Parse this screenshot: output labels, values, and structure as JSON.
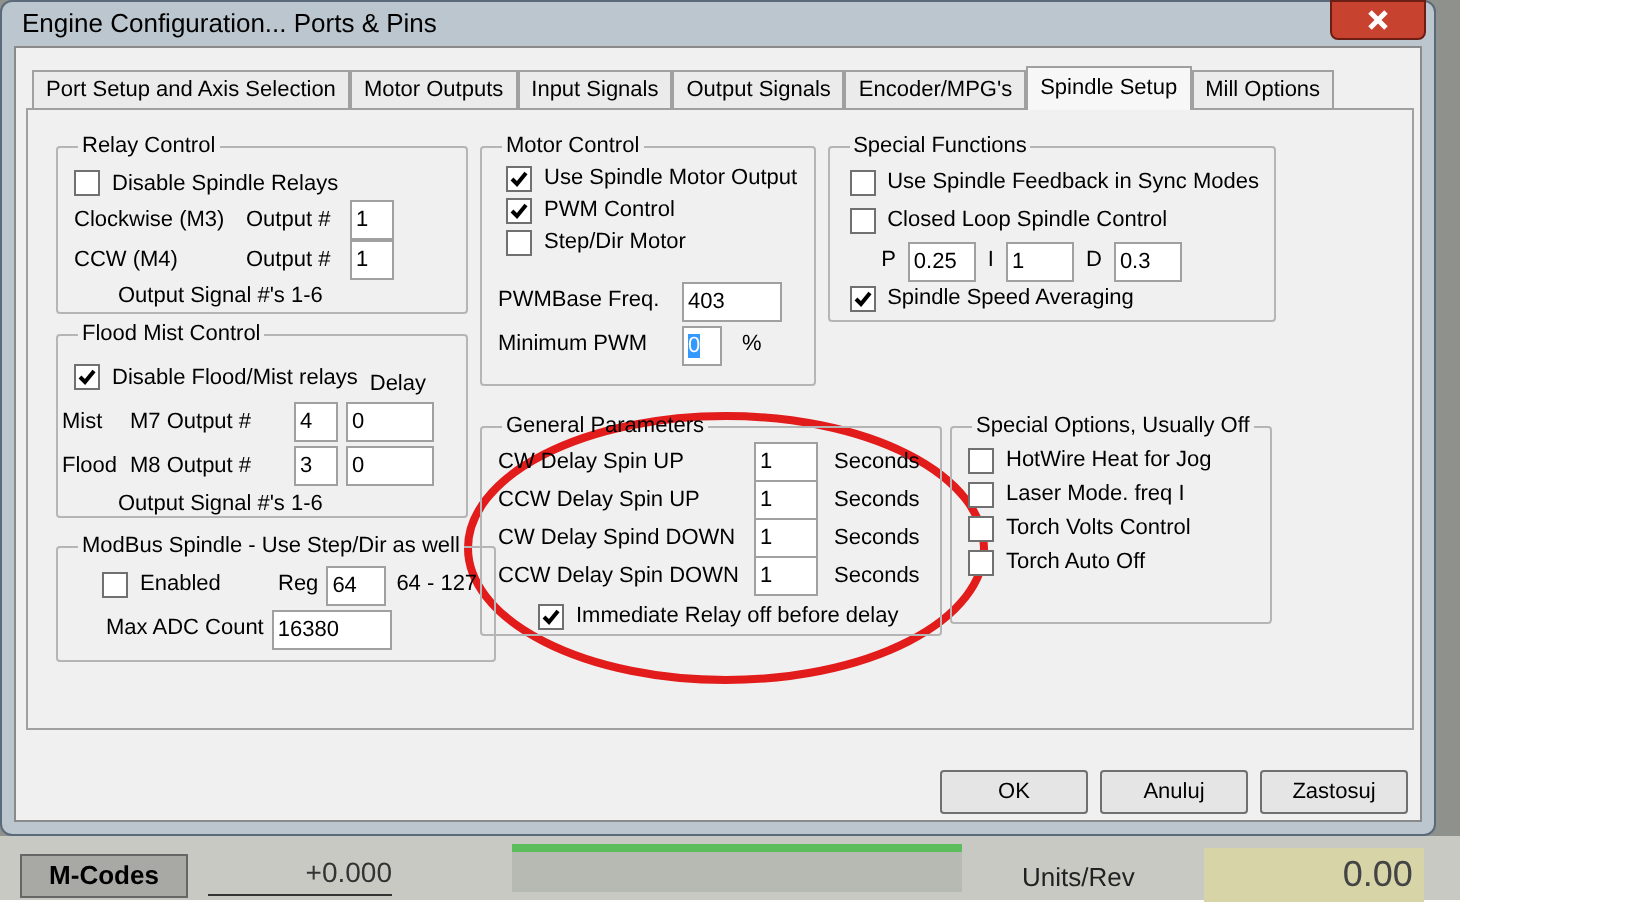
{
  "window": {
    "title": "Engine Configuration... Ports & Pins"
  },
  "tabs": [
    {
      "label": "Port Setup and Axis Selection",
      "selected": false
    },
    {
      "label": "Motor Outputs",
      "selected": false
    },
    {
      "label": "Input Signals",
      "selected": false
    },
    {
      "label": "Output Signals",
      "selected": false
    },
    {
      "label": "Encoder/MPG's",
      "selected": false
    },
    {
      "label": "Spindle Setup",
      "selected": true
    },
    {
      "label": "Mill Options",
      "selected": false
    }
  ],
  "relay_control": {
    "title": "Relay Control",
    "disable": {
      "label": "Disable Spindle Relays",
      "checked": false
    },
    "rows": [
      {
        "label": "Clockwise (M3)",
        "output_label": "Output #",
        "value": "1"
      },
      {
        "label": "CCW (M4)",
        "output_label": "Output #",
        "value": "1"
      }
    ],
    "note": "Output Signal #'s 1-6"
  },
  "flood_mist": {
    "title": "Flood Mist Control",
    "disable": {
      "label": "Disable Flood/Mist relays",
      "checked": true
    },
    "delay_label": "Delay",
    "rows": [
      {
        "name": "Mist",
        "label": "M7 Output #",
        "output": "4",
        "delay": "0"
      },
      {
        "name": "Flood",
        "label": "M8 Output #",
        "output": "3",
        "delay": "0"
      }
    ],
    "note": "Output Signal #'s 1-6"
  },
  "modbus": {
    "title": "ModBus Spindle - Use Step/Dir as well",
    "enabled": {
      "label": "Enabled",
      "checked": false
    },
    "reg_label": "Reg",
    "reg": "64",
    "range": "64 - 127",
    "adc_label": "Max ADC Count",
    "adc": "16380"
  },
  "motor_control": {
    "title": "Motor Control",
    "options": [
      {
        "label": "Use Spindle Motor Output",
        "checked": true
      },
      {
        "label": "PWM Control",
        "checked": true
      },
      {
        "label": "Step/Dir Motor",
        "checked": false
      }
    ],
    "fields": [
      {
        "label": "PWMBase Freq.",
        "value": "403",
        "focused": false
      },
      {
        "label": "Minimum PWM",
        "value": "0",
        "unit": "%",
        "focused": true
      }
    ]
  },
  "special_functions": {
    "title": "Special Functions",
    "options": [
      {
        "label": "Use Spindle Feedback in Sync Modes",
        "checked": false
      },
      {
        "label": "Closed Loop Spindle Control",
        "checked": false
      }
    ],
    "pid": [
      {
        "label": "P",
        "value": "0.25"
      },
      {
        "label": "I",
        "value": "1"
      },
      {
        "label": "D",
        "value": "0.3"
      }
    ],
    "averaging": {
      "label": "Spindle Speed Averaging",
      "checked": true
    }
  },
  "general_parameters": {
    "title": "General Parameters",
    "rows": [
      {
        "label": "CW Delay Spin UP",
        "value": "1",
        "unit": "Seconds"
      },
      {
        "label": "CCW Delay Spin UP",
        "value": "1",
        "unit": "Seconds"
      },
      {
        "label": "CW Delay Spind DOWN",
        "value": "1",
        "unit": "Seconds"
      },
      {
        "label": "CCW Delay Spin DOWN",
        "value": "1",
        "unit": "Seconds"
      }
    ],
    "immediate": {
      "label": "Immediate Relay off before delay",
      "checked": true
    }
  },
  "special_options": {
    "title": "Special Options, Usually Off",
    "options": [
      {
        "label": "HotWire Heat for Jog",
        "checked": false
      },
      {
        "label": "Laser Mode. freq I",
        "checked": false
      },
      {
        "label": "Torch Volts Control",
        "checked": false
      },
      {
        "label": "Torch Auto Off",
        "checked": false
      }
    ]
  },
  "buttons": [
    "OK",
    "Anuluj",
    "Zastosuj"
  ],
  "background": {
    "mcodes": "M-Codes",
    "value": "+0.000",
    "units_label": "Units/Rev",
    "units_value": "0.00"
  }
}
